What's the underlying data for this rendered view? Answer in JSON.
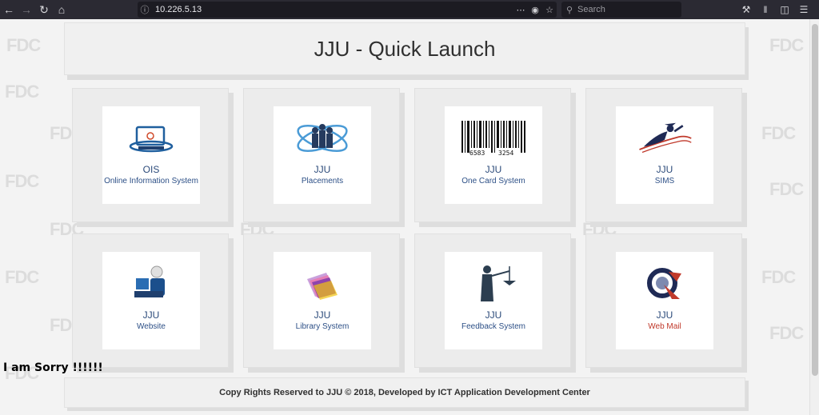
{
  "browser": {
    "url": "10.226.5.13",
    "search_placeholder": "Search"
  },
  "page": {
    "title": "JJU - Quick Launch",
    "watermark": "FDC",
    "footer": "Copy Rights Reserved to JJU © 2018, Developed by ICT Application Development Center",
    "notice": "I am Sorry !!!!!!"
  },
  "tiles": [
    {
      "title": "OIS",
      "subtitle": "Online Information System"
    },
    {
      "title": "JJU",
      "subtitle": "Placements"
    },
    {
      "title": "JJU",
      "subtitle": "One Card System",
      "barcode_left": "6583",
      "barcode_right": "3254"
    },
    {
      "title": "JJU",
      "subtitle": "SIMS"
    },
    {
      "title": "JJU",
      "subtitle": "Website"
    },
    {
      "title": "JJU",
      "subtitle": "Library System"
    },
    {
      "title": "JJU",
      "subtitle": "Feedback System"
    },
    {
      "title": "JJU",
      "subtitle": "Web Mail"
    }
  ],
  "colors": {
    "chrome": "#2b2a33",
    "urlbar": "#1c1b22",
    "accent_blue": "#2c4f86",
    "webmail_red": "#c0392b"
  }
}
